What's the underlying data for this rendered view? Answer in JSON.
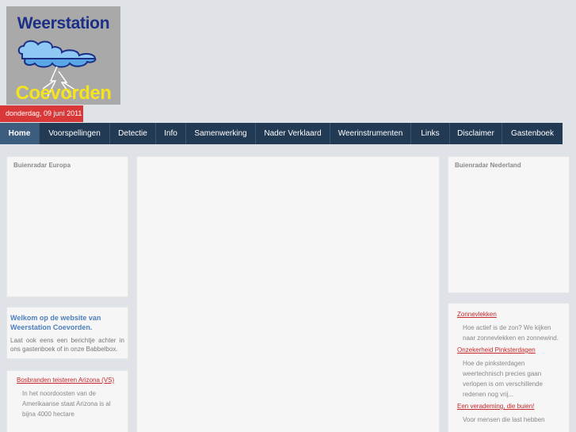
{
  "logo": {
    "line1": "Weerstation",
    "line2": "Coevorden"
  },
  "date": "donderdag, 09 juni 2011",
  "nav": {
    "items": [
      {
        "label": "Home",
        "active": true
      },
      {
        "label": "Voorspellingen",
        "active": false
      },
      {
        "label": "Detectie",
        "active": false
      },
      {
        "label": "Info",
        "active": false
      },
      {
        "label": "Samenwerking",
        "active": false
      },
      {
        "label": "Nader Verklaard",
        "active": false
      },
      {
        "label": "Weerinstrumenten",
        "active": false
      },
      {
        "label": "Links",
        "active": false
      },
      {
        "label": "Disclaimer",
        "active": false
      },
      {
        "label": "Gastenboek",
        "active": false
      }
    ]
  },
  "left": {
    "radar_title": "Buienradar Europa",
    "welcome_title": "Welkom op de website van Weerstation Coevorden.",
    "welcome_text": "Laat ook eens een berichtje achter in ons gastenboek of in onze Babbelbox.",
    "news": {
      "link": "Bosbranden teisteren Arizona (VS)",
      "text": "In het noordoosten van de Amerikaanse staat Arizona is al bijna 4000 hectare"
    }
  },
  "right": {
    "radar_title": "Buienradar Nederland",
    "articles": [
      {
        "link": "Zonnevlekken",
        "text": "Hoe actief is de zon? We kijken naar zonnevlekken en zonnewind."
      },
      {
        "link": "Onzekerheid Pinksterdagen",
        "text": "Hoe de pinksterdagen weertechnisch precies gaan verlopen is om verschillende redenen nog vrij..."
      },
      {
        "link": "Een verademing, die buien!",
        "text": "Voor mensen die last hebben"
      }
    ]
  },
  "colors": {
    "background": "#dfe3e7",
    "nav": "#233a55",
    "nav_active": "#3d5d7f",
    "date_bar": "#d93838",
    "link": "#c6282c",
    "welcome_title": "#4d7fbd"
  }
}
